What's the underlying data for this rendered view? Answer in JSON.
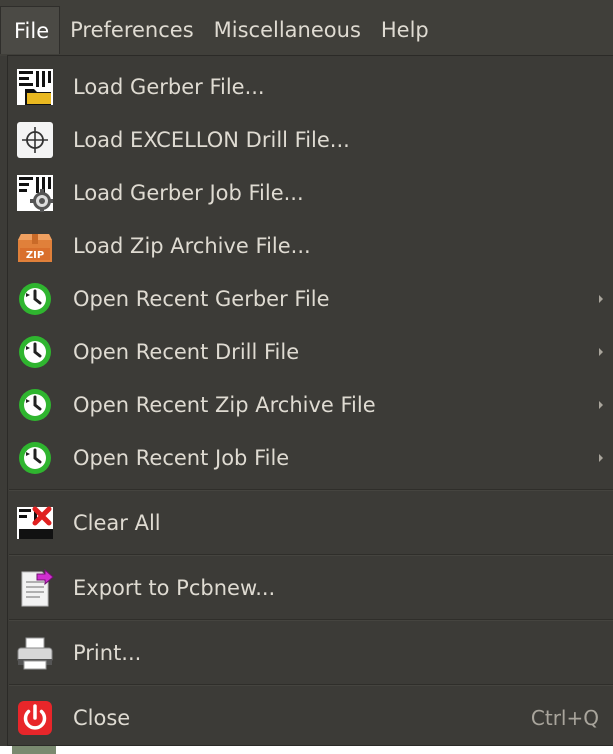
{
  "menubar": {
    "items": [
      "File",
      "Preferences",
      "Miscellaneous",
      "Help"
    ]
  },
  "file_menu": {
    "items": [
      {
        "label": "Load Gerber File...",
        "icon": "gerber-file-icon"
      },
      {
        "label": "Load EXCELLON Drill File...",
        "icon": "drill-crosshair-icon"
      },
      {
        "label": "Load Gerber Job File...",
        "icon": "gerber-job-gear-icon"
      },
      {
        "label": "Load Zip Archive File...",
        "icon": "zip-archive-icon"
      },
      {
        "label": "Open Recent Gerber File",
        "icon": "recent-clock-icon",
        "submenu": true
      },
      {
        "label": "Open Recent Drill File",
        "icon": "recent-clock-icon",
        "submenu": true
      },
      {
        "label": "Open Recent Zip Archive File",
        "icon": "recent-clock-icon",
        "submenu": true
      },
      {
        "label": "Open Recent Job File",
        "icon": "recent-clock-icon",
        "submenu": true
      },
      {
        "label": "Clear All",
        "icon": "clear-all-icon"
      },
      {
        "label": "Export to Pcbnew...",
        "icon": "export-pcbnew-icon"
      },
      {
        "label": "Print...",
        "icon": "printer-icon"
      },
      {
        "label": "Close",
        "icon": "power-icon",
        "accelerator": "Ctrl+Q"
      }
    ]
  },
  "colors": {
    "menu_bg": "#3c3b37",
    "text": "#dfdbd2",
    "active_menu_bg": "#4b4a45",
    "clock_green": "#2fb52f",
    "power_red": "#e8262a",
    "zip_orange": "#e0803a"
  }
}
